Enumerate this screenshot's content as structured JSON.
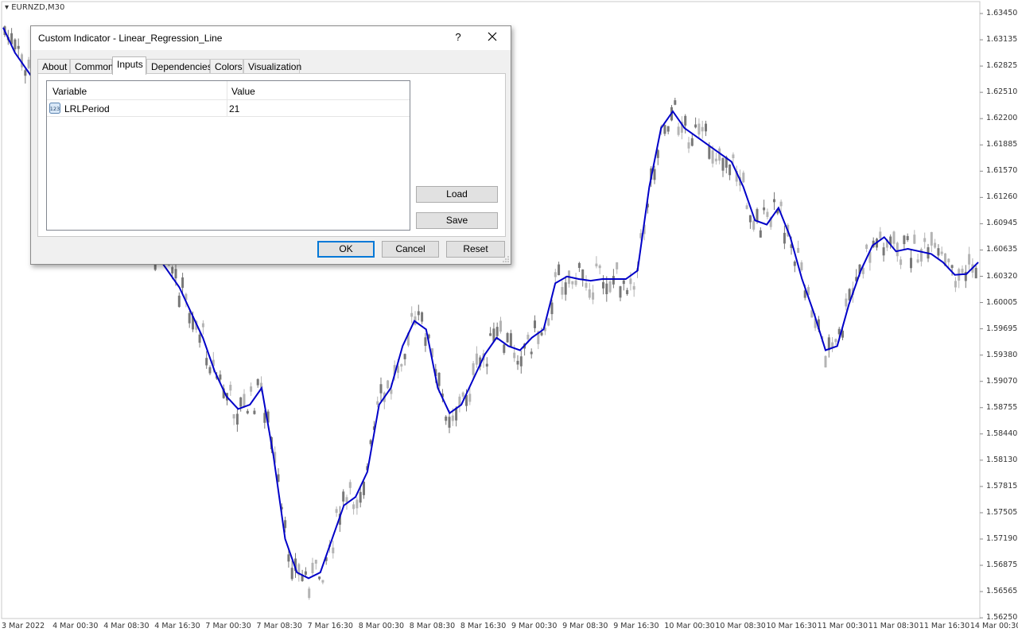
{
  "chart": {
    "symbol": "EURNZD,M30",
    "colors": {
      "line": "#0000c8",
      "candle_up": "#b4b4b4",
      "candle_down": "#787878",
      "frame": "#c8c8c8"
    },
    "price_labels": [
      "1.63450",
      "1.63135",
      "1.62825",
      "1.62510",
      "1.62200",
      "1.61885",
      "1.61570",
      "1.61260",
      "1.60945",
      "1.60635",
      "1.60320",
      "1.60005",
      "1.59695",
      "1.59380",
      "1.59070",
      "1.58755",
      "1.58440",
      "1.58130",
      "1.57815",
      "1.57505",
      "1.57190",
      "1.56875",
      "1.56565",
      "1.56250"
    ],
    "time_labels": [
      "3 Mar 2022",
      "4 Mar 00:30",
      "4 Mar 08:30",
      "4 Mar 16:30",
      "7 Mar 00:30",
      "7 Mar 08:30",
      "7 Mar 16:30",
      "8 Mar 00:30",
      "8 Mar 08:30",
      "8 Mar 16:30",
      "9 Mar 00:30",
      "9 Mar 08:30",
      "9 Mar 16:30",
      "10 Mar 00:30",
      "10 Mar 08:30",
      "10 Mar 16:30",
      "11 Mar 00:30",
      "11 Mar 08:30",
      "11 Mar 16:30",
      "14 Mar 00:30"
    ]
  },
  "chart_data": {
    "type": "line",
    "xlabel": "",
    "ylabel": "",
    "ylim": [
      1.5625,
      1.6361
    ],
    "series": [
      {
        "values": [
          1.633,
          1.63,
          1.628,
          1.626,
          1.624,
          1.622,
          1.62,
          1.618,
          1.616,
          1.614,
          1.612,
          1.61,
          1.608,
          1.606,
          1.604,
          1.602,
          1.599,
          1.596,
          1.592,
          1.589,
          1.5875,
          1.588,
          1.59,
          1.582,
          1.572,
          1.568,
          1.5673,
          1.568,
          1.572,
          1.576,
          1.577,
          1.58,
          1.588,
          1.59,
          1.595,
          1.598,
          1.597,
          1.59,
          1.587,
          1.588,
          1.591,
          1.594,
          1.596,
          1.595,
          1.5945,
          1.596,
          1.597,
          1.6025,
          1.6033,
          1.603,
          1.6028,
          1.603,
          1.603,
          1.603,
          1.604,
          1.614,
          1.621,
          1.623,
          1.621,
          1.62,
          1.619,
          1.618,
          1.617,
          1.614,
          1.61,
          1.6095,
          1.6115,
          1.608,
          1.603,
          1.599,
          1.5945,
          1.595,
          1.6,
          1.604,
          1.607,
          1.608,
          1.6063,
          1.6066,
          1.6063,
          1.606,
          1.605,
          1.6035,
          1.6036,
          1.605
        ]
      }
    ]
  },
  "dialog": {
    "title": "Custom Indicator - Linear_Regression_Line",
    "help": "?",
    "tabs": [
      "About",
      "Common",
      "Inputs",
      "Dependencies",
      "Colors",
      "Visualization"
    ],
    "active_tab": "Inputs",
    "grid": {
      "headers": [
        "Variable",
        "Value"
      ],
      "rows": [
        {
          "icon": "123",
          "variable": "LRLPeriod",
          "value": "21"
        }
      ]
    },
    "side_buttons": {
      "load": "Load",
      "save": "Save"
    },
    "buttons": {
      "ok": "OK",
      "cancel": "Cancel",
      "reset": "Reset"
    },
    "accent": "#0078d7"
  }
}
